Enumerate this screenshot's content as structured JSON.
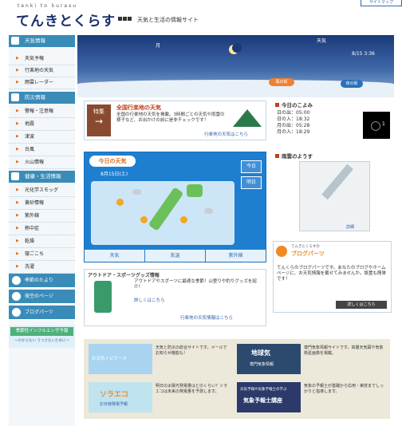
{
  "header": {
    "logo_sub": "tenki to kurasu",
    "logo": "てんきとくらす",
    "tagline": "天気と生活の情報サイト",
    "sitemap": "サイトマップ"
  },
  "sidebar": {
    "sections": [
      {
        "title": "天気情報",
        "items": [
          "天気予報",
          "行楽地の天気",
          "雨雲レーダー"
        ]
      },
      {
        "title": "防災情報",
        "items": [
          "警報・注意報",
          "地震",
          "津波",
          "台風",
          "火山情報"
        ]
      },
      {
        "title": "健康・生活情報",
        "items": [
          "光化学スモッグ",
          "黄砂情報",
          "紫外線",
          "熱中症",
          "乾燥",
          "寝ごこち",
          "洗濯"
        ]
      }
    ],
    "buttons": [
      "季節のたより",
      "夜空のページ",
      "ブログパーツ"
    ],
    "flu": {
      "title": "季節性インフルエンザ予報",
      "sub": "〜かからない うつさないために〜"
    }
  },
  "hero": {
    "moon_label": "月",
    "sky_label": "天気",
    "date": "8/15 3:36",
    "sign_home": "風の街",
    "sign_sun": "夜の街"
  },
  "feature": {
    "badge": "特集",
    "title": "全国行楽地の天気",
    "desc": "全国の行楽地の天気を掲載。3時間ごとの天気や雨雲の様子など、お出かけの前に是非チェックです！",
    "link": "行楽地の天気はこちら"
  },
  "today": {
    "title": "今日の天気",
    "date": "8月15日(土)",
    "btn_today": "今日",
    "btn_tomorrow": "明日",
    "tabs": [
      "天気",
      "気温",
      "紫外線"
    ]
  },
  "calendar": {
    "title": "今日のこよみ",
    "rows": [
      {
        "label": "日の出",
        "time": "05:00"
      },
      {
        "label": "日の入",
        "time": "18:32"
      },
      {
        "label": "月の出",
        "time": "05:28"
      },
      {
        "label": "月の入",
        "time": "18:29"
      }
    ],
    "moon_age": "1"
  },
  "clouds": {
    "title": "雨雲のようす",
    "link": "詳細"
  },
  "outdoor": {
    "title": "アウトドア・スポーツグッズ情報",
    "desc": "アウトドアやスポーツに最適な季節！山登りや釣りグッズを紹介！",
    "more": "詳しくはこちら",
    "link": "行楽地の天気情報はこちら"
  },
  "blog": {
    "small": "てんきとくらすの",
    "title": "ブログパーツ",
    "desc": "てんくらのブログパーツです。あなたのブログやホームページに、お天気情報を載せてみませんか。設置も簡単です！",
    "more": "詳しくはこちら"
  },
  "banners": [
    {
      "img": "お天気ナビゲータ",
      "desc": "天気と防災の総合サイトです。メールでお知らせ機能も！"
    },
    {
      "img": "地球気",
      "img_sub": "専門気象情報",
      "desc": "専門気象情報サイトです。高層天気図や気象衛星画像を掲載。"
    },
    {
      "img": "ソラエコ",
      "img_sub": "お日様発電予報",
      "desc": "明日の太陽光発電量はどのくらい？ソラエコは未来の発電量を予測します。"
    },
    {
      "img": "気象予報士講座",
      "img_sub": "天気予報や気象予報士の学ぶ",
      "desc": "気象の予報士が基礎から応用・実技までしっかりと指導します。"
    }
  ]
}
